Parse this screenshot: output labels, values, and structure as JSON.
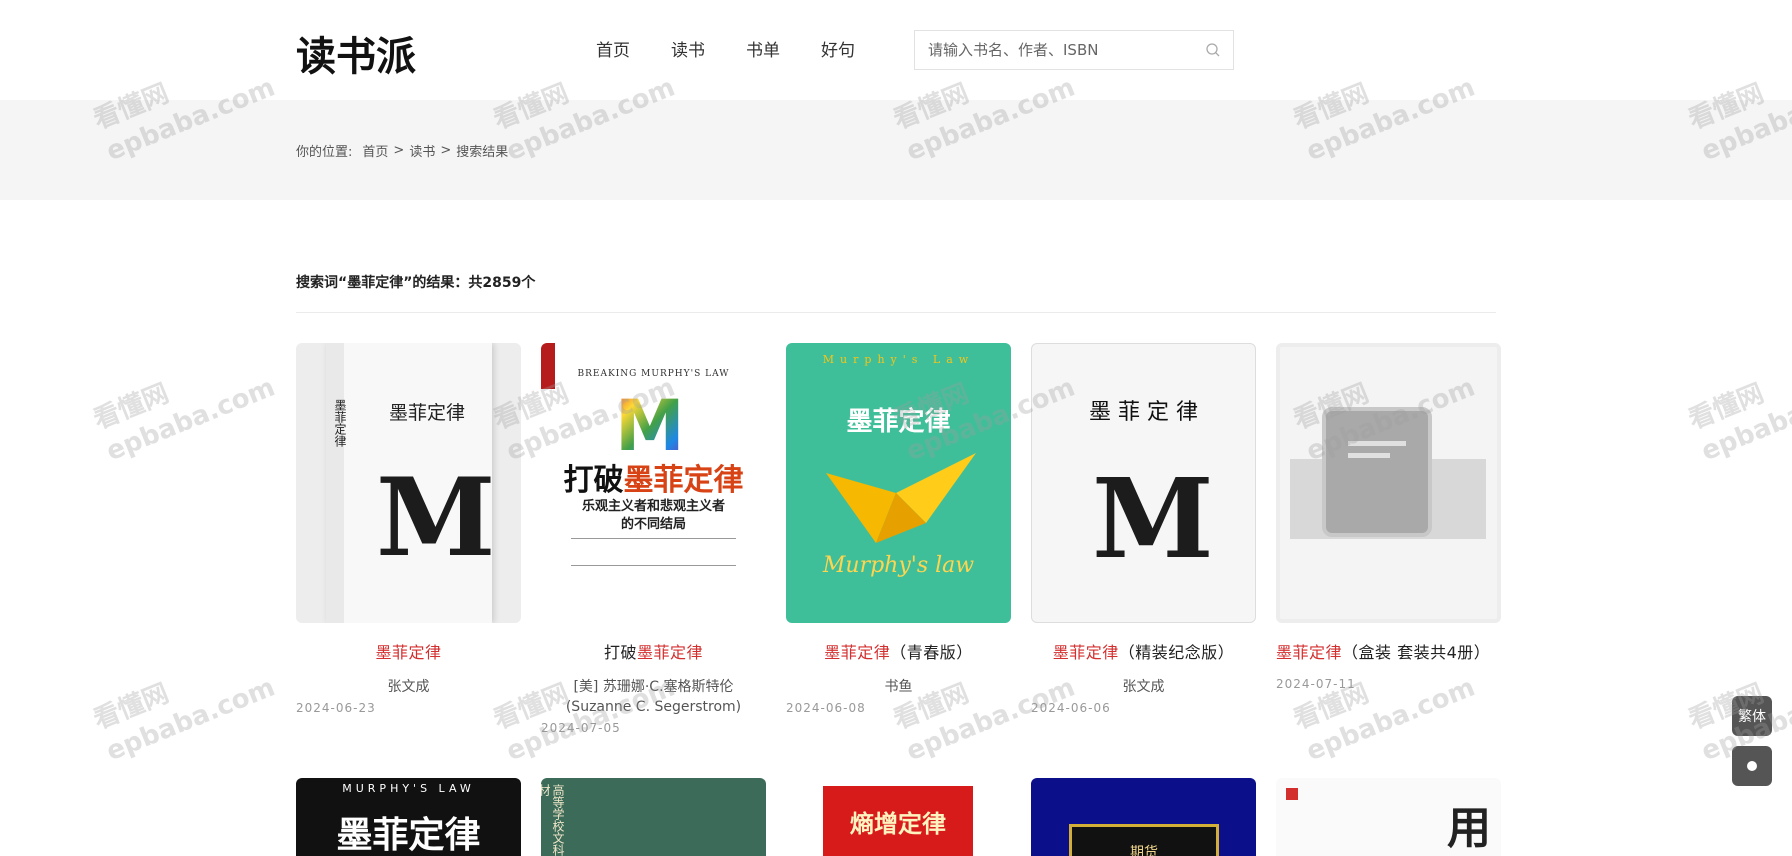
{
  "header": {
    "logo": "读书派",
    "nav": [
      "首页",
      "读书",
      "书单",
      "好句"
    ],
    "search_placeholder": "请输入书名、作者、ISBN"
  },
  "breadcrumb": {
    "prefix": "你的位置:",
    "items": [
      "首页",
      "读书",
      "搜索结果"
    ],
    "separator": ">"
  },
  "results": {
    "summary": "搜索词“墨菲定律”的结果：共2859个",
    "books": [
      {
        "title_pre": "",
        "title_hl": "墨菲定律",
        "title_post": "",
        "author": "张文成",
        "date": "2024-06-23"
      },
      {
        "title_pre": "打破",
        "title_hl": "墨菲定律",
        "title_post": "",
        "author": "[美] 苏珊娜·C.塞格斯特伦(Suzanne C. Segerstrom)",
        "date": "2024-07-05"
      },
      {
        "title_pre": "",
        "title_hl": "墨菲定律",
        "title_post": "（青春版）",
        "author": "书鱼",
        "date": "2024-06-08"
      },
      {
        "title_pre": "",
        "title_hl": "墨菲定律",
        "title_post": "（精装纪念版）",
        "author": "张文成",
        "date": "2024-06-06"
      },
      {
        "title_pre": "",
        "title_hl": "墨菲定律",
        "title_post": "（盒装 套装共4册）",
        "author": "",
        "date": "2024-07-11"
      }
    ],
    "row2_covers": [
      {
        "top": "MURPHY'S LAW",
        "main": "墨菲定律"
      },
      {
        "main": "高等学校文科教材"
      },
      {
        "main": "熵增定律"
      },
      {
        "main": "期货"
      },
      {
        "main": "用"
      }
    ]
  },
  "covers": {
    "c1": {
      "vertical_title": "墨菲定律",
      "title": "墨菲定律",
      "letter": "M"
    },
    "c2": {
      "top": "BREAKING MURPHY'S LAW",
      "title_a": "打破",
      "title_b": "墨菲定律",
      "subtitle1": "乐观主义者和悲观主义者",
      "subtitle2": "的不同结局",
      "letter": "M"
    },
    "c3": {
      "top": "Murphy's Law",
      "title": "墨菲定律",
      "script": "Murphy's law"
    },
    "c4": {
      "title": "墨 菲 定 律",
      "letter": "M"
    }
  },
  "floating": {
    "traditional": "繁体"
  },
  "watermark": {
    "line1": "看懂网",
    "line2": "epbaba.com"
  },
  "colors": {
    "highlight": "#d32f2f",
    "teal_cover": "#3fbf99"
  }
}
